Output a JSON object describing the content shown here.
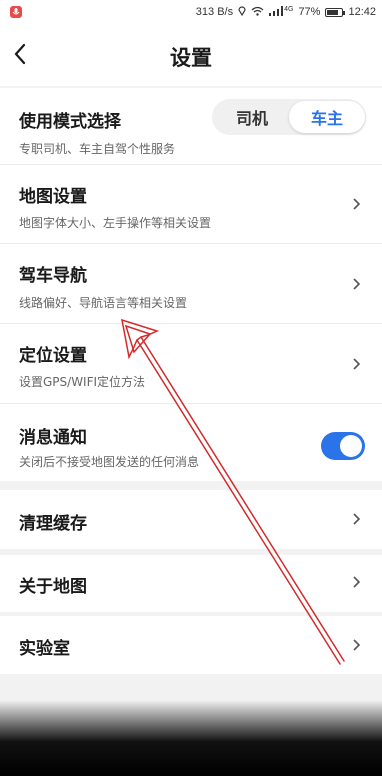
{
  "status_bar": {
    "speed": "313 B/s",
    "network": "4G",
    "battery": "77%",
    "battery_level": 0.77,
    "time": "12:42"
  },
  "header": {
    "title": "设置"
  },
  "settings": {
    "mode": {
      "title": "使用模式选择",
      "subtitle": "专职司机、车主自驾个性服务",
      "options": [
        "司机",
        "车主"
      ],
      "selected": "车主"
    },
    "map_settings": {
      "title": "地图设置",
      "subtitle": "地图字体大小、左手操作等相关设置"
    },
    "driving_nav": {
      "title": "驾车导航",
      "subtitle": "线路偏好、导航语言等相关设置"
    },
    "location": {
      "title": "定位设置",
      "subtitle": "设置GPS/WIFI定位方法"
    },
    "notifications": {
      "title": "消息通知",
      "subtitle": "关闭后不接受地图发送的任何消息",
      "enabled": true
    },
    "clear_cache": {
      "title": "清理缓存"
    },
    "about_map": {
      "title": "关于地图"
    },
    "lab": {
      "title": "实验室"
    }
  },
  "colors": {
    "accent": "#2a73e8",
    "annotation": "#d42a2a"
  }
}
